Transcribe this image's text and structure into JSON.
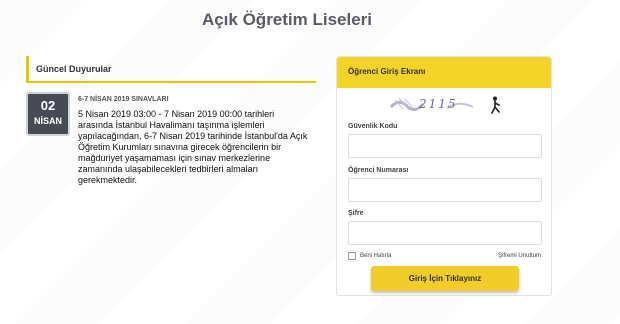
{
  "header": {
    "title": "Açık Öğretim Liseleri"
  },
  "announcements": {
    "heading": "Güncel Duyurular",
    "items": [
      {
        "day": "02",
        "month": "NİSAN",
        "title": "6-7 NİSAN 2019 SINAVLARI",
        "body": "5 Nisan 2019 03:00 - 7 Nisan 2019 00:00 tarihleri arasında İstanbul Havalimanı taşınma işlemleri yapılacağından, 6-7 Nisan 2019 tarihinde İstanbul'da Açık Öğretim Kurumları sınavına girecek öğrencilerin bir mağduriyet yaşamaması için sınav merkezlerine zamanında ulaşabilecekleri tedbirleri almaları gerekmektedir."
      }
    ]
  },
  "login": {
    "heading": "Öğrenci Giriş Ekranı",
    "captcha_text": "2115",
    "security_code_label": "Güvenlik Kodu",
    "security_code_value": "",
    "student_number_label": "Öğrenci Numarası",
    "student_number_value": "",
    "password_label": "Şifre",
    "password_value": "",
    "remember_label": "Beni Hatırla",
    "forgot_label": "Şifremi Unuttum",
    "submit_label": "Giriş İçin Tıklayınız"
  },
  "colors": {
    "accent_yellow": "#f4d328",
    "badge_dark": "#454a54",
    "title_gray": "#5a5a6a"
  }
}
